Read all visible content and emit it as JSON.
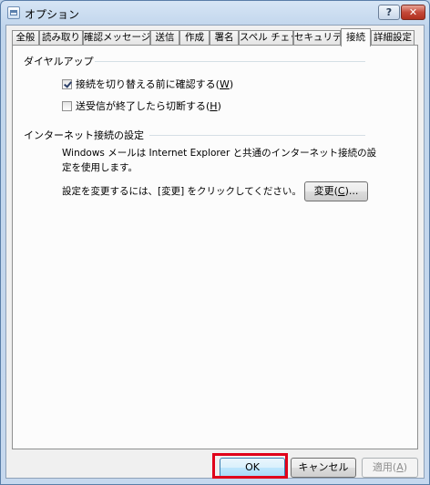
{
  "window": {
    "title": "オプション",
    "help_label": "?",
    "close_label": "✕"
  },
  "tabs": [
    {
      "label": "全般",
      "active": false
    },
    {
      "label": "読み取り",
      "active": false
    },
    {
      "label": "確認メッセージ",
      "active": false
    },
    {
      "label": "送信",
      "active": false
    },
    {
      "label": "作成",
      "active": false
    },
    {
      "label": "署名",
      "active": false
    },
    {
      "label": "スペル チェック",
      "active": false
    },
    {
      "label": "セキュリティ",
      "active": false
    },
    {
      "label": "接続",
      "active": true
    },
    {
      "label": "詳細設定",
      "active": false
    }
  ],
  "dialup": {
    "title": "ダイヤルアップ",
    "confirm_switch": {
      "label": "接続を切り替える前に確認する(",
      "key": "W",
      "close": ")",
      "checked": true
    },
    "hangup": {
      "label": "送受信が終了したら切断する(",
      "key": "H",
      "close": ")",
      "checked": false
    }
  },
  "internet": {
    "title": "インターネット接続の設定",
    "desc_line1": "Windows メールは Internet Explorer と共通のインターネット接続の設",
    "desc_line2": "定を使用します。",
    "change_hint": "設定を変更するには、[変更] をクリックしてください。",
    "change_button": {
      "label": "変更(",
      "key": "C",
      "close": ")..."
    }
  },
  "footer": {
    "ok_label": "OK",
    "cancel_label": "キャンセル",
    "apply": {
      "label": "適用(",
      "key": "A",
      "close": ")"
    }
  },
  "colors": {
    "highlight": "#e0001a",
    "title_bar": "#c0d5ec"
  }
}
